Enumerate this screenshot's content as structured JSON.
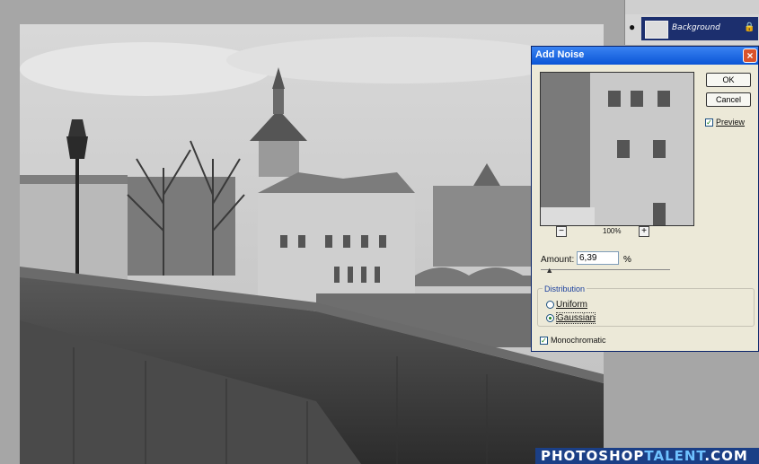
{
  "layers": {
    "layer_name": "Background",
    "icons": [
      "eye-icon",
      "layer-thumbnail",
      "lock-icon"
    ]
  },
  "canvas": {
    "image_description_icons": [
      "photo-canvas"
    ]
  },
  "dialog": {
    "title": "Add Noise",
    "ok_label": "OK",
    "cancel_label": "Cancel",
    "preview_label": "Preview",
    "preview_checked": true,
    "zoom_minus": "−",
    "zoom_plus": "+",
    "zoom_level": "100%",
    "amount_label": "Amount:",
    "amount_value": "6,39",
    "amount_unit": "%",
    "slider_fraction": 0.0639,
    "distribution_label": "Distribution",
    "uniform_label": "Uniform",
    "gaussian_label": "Gaussian",
    "gaussian_selected": true,
    "monochromatic_label": "Monochromatic",
    "monochromatic_checked": true,
    "accent_color": "#0a55d6"
  },
  "watermark": {
    "text_a": "PHOTOSHOP",
    "text_b": "TALENT",
    "text_c": ".COM"
  }
}
